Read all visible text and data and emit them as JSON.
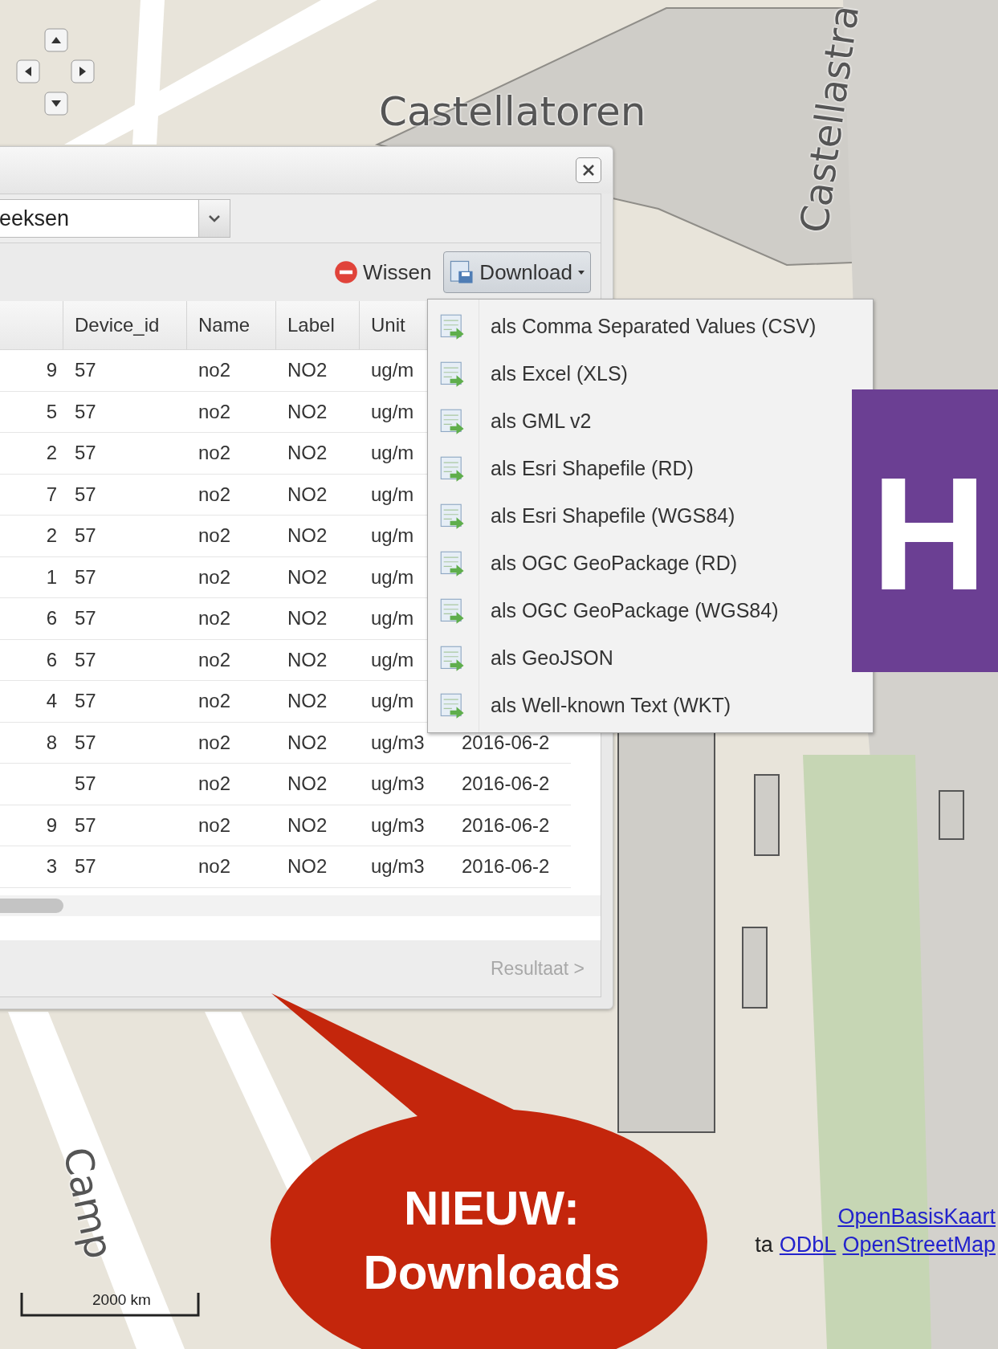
{
  "map": {
    "labels": [
      {
        "text": "Castellatoren",
        "kind": "horizontal"
      },
      {
        "text": "Castellastra",
        "kind": "up"
      },
      {
        "text": "Camp",
        "kind": "down"
      }
    ]
  },
  "dialog": {
    "combo": {
      "value": "eeksen"
    },
    "toolbar": {
      "clear_button": "Wissen",
      "download_button": {
        "label": "Download",
        "expanded": true
      }
    },
    "table": {
      "columns": [
        "Device_id",
        "Name",
        "Label",
        "Unit"
      ],
      "rows": [
        {
          "column_1": "9",
          "device_id": "57",
          "name": "no2",
          "label": "NO2",
          "unit": "ug/m"
        },
        {
          "column_1": "5",
          "device_id": "57",
          "name": "no2",
          "label": "NO2",
          "unit": "ug/m"
        },
        {
          "column_1": "2",
          "device_id": "57",
          "name": "no2",
          "label": "NO2",
          "unit": "ug/m"
        },
        {
          "column_1": "7",
          "device_id": "57",
          "name": "no2",
          "label": "NO2",
          "unit": "ug/m"
        },
        {
          "column_1": "2",
          "device_id": "57",
          "name": "no2",
          "label": "NO2",
          "unit": "ug/m"
        },
        {
          "column_1": "1",
          "device_id": "57",
          "name": "no2",
          "label": "NO2",
          "unit": "ug/m"
        },
        {
          "column_1": "6",
          "device_id": "57",
          "name": "no2",
          "label": "NO2",
          "unit": "ug/m"
        },
        {
          "column_1": "6",
          "device_id": "57",
          "name": "no2",
          "label": "NO2",
          "unit": "ug/m"
        },
        {
          "column_1": "4",
          "device_id": "57",
          "name": "no2",
          "label": "NO2",
          "unit": "ug/m"
        },
        {
          "column_1": "8",
          "device_id": "57",
          "name": "no2",
          "label": "NO2",
          "unit": "ug/m3",
          "column_6": "2016-06-2"
        },
        {
          "device_id": "57",
          "name": "no2",
          "label": "NO2",
          "unit": "ug/m3",
          "column_6": "2016-06-2"
        },
        {
          "column_1": "9",
          "device_id": "57",
          "name": "no2",
          "label": "NO2",
          "unit": "ug/m3",
          "column_6": "2016-06-2"
        },
        {
          "column_1": "3",
          "device_id": "57",
          "name": "no2",
          "label": "NO2",
          "unit": "ug/m3",
          "column_6": "2016-06-2"
        }
      ]
    },
    "footer": {
      "next_button": {
        "label": "Resultaat >",
        "disabled": true
      }
    }
  },
  "download_menu": {
    "items": [
      {
        "label": "als Comma Separated Values (CSV)"
      },
      {
        "label": "als Excel (XLS)"
      },
      {
        "label": "als GML v2"
      },
      {
        "label": "als Esri Shapefile (RD)"
      },
      {
        "label": "als Esri Shapefile (WGS84)"
      },
      {
        "label": "als OGC GeoPackage (RD)"
      },
      {
        "label": "als OGC GeoPackage (WGS84)"
      },
      {
        "label": "als GeoJSON"
      },
      {
        "label": "als Well-known Text (WKT)"
      }
    ]
  },
  "banner": {
    "text": "H"
  },
  "callout": {
    "lines": [
      "NIEUW:",
      "Downloads"
    ]
  },
  "attribution": {
    "lines": [
      [
        {
          "text": "OpenBasisKaart",
          "kind": "link"
        }
      ],
      [
        {
          "text": "ta",
          "kind": "text"
        },
        {
          "text": "ODbL",
          "kind": "link"
        },
        {
          "text": "OpenStreetMap",
          "kind": "link"
        }
      ]
    ]
  },
  "scale_bar": {
    "label": "2000 km"
  }
}
